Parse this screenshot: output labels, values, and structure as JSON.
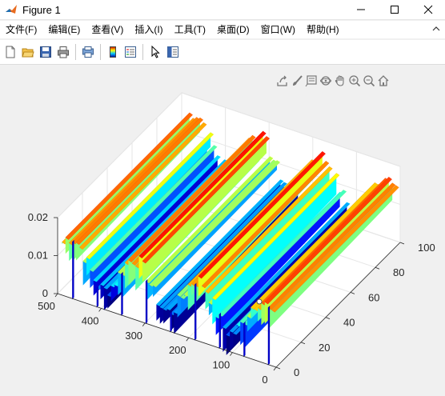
{
  "window": {
    "title": "Figure 1"
  },
  "menubar": {
    "items": [
      {
        "label": "文件(F)"
      },
      {
        "label": "编辑(E)"
      },
      {
        "label": "查看(V)"
      },
      {
        "label": "插入(I)"
      },
      {
        "label": "工具(T)"
      },
      {
        "label": "桌面(D)"
      },
      {
        "label": "窗口(W)"
      },
      {
        "label": "帮助(H)"
      }
    ]
  },
  "toolbar": {
    "icons": [
      "new-figure-icon",
      "open-file-icon",
      "save-icon",
      "print-icon",
      "print-preview-icon",
      "colorbar-icon",
      "legend-icon",
      "edit-plot-arrow-icon",
      "property-inspector-icon"
    ]
  },
  "axes_toolbar": {
    "icons": [
      "export-icon",
      "brush-icon",
      "data-tips-icon",
      "rotate-3d-icon",
      "pan-icon",
      "zoom-in-icon",
      "zoom-out-icon",
      "home-icon"
    ]
  },
  "colors": {
    "colormap": "jet",
    "axes_bg": "#ffffff",
    "figure_bg": "#f0f0f0",
    "grid": "#e6e6e6"
  },
  "chart_data": {
    "type": "surface",
    "xlabel": "",
    "ylabel": "",
    "zlabel": "",
    "title": "",
    "xlim": [
      0,
      500
    ],
    "ylim": [
      0,
      100
    ],
    "zlim": [
      0,
      0.02
    ],
    "x_ticks": [
      "0",
      "100",
      "200",
      "300",
      "400",
      "500"
    ],
    "y_ticks": [
      "0",
      "20",
      "40",
      "60",
      "80",
      "100"
    ],
    "z_ticks": [
      "0",
      "0.01",
      "0.02"
    ],
    "grid": true,
    "colormap": "jet"
  }
}
